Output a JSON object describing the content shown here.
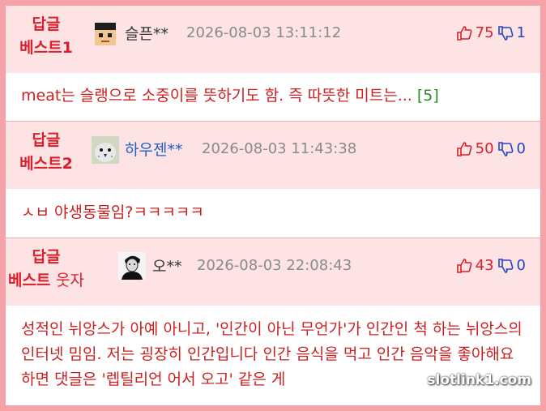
{
  "colors": {
    "border": "#f5a3a8",
    "header_bg": "#fde3e4",
    "badge": "#d81e2b",
    "text": "#cc1f1f",
    "up": "#d81e2b",
    "down": "#1f45c7"
  },
  "comments": [
    {
      "badge_line1": "답글",
      "badge_line2": "베스트1",
      "badge_extra": "",
      "avatar_icon": "pixel-face-avatar",
      "username": "슬픈**",
      "date": "2026-08-03 13:11:12",
      "up": "75",
      "down": "1",
      "body": "meat는 슬랭으로 소중이를 뜻하기도 함. 즉 따뜻한 미트는...",
      "reply_count": "[5]"
    },
    {
      "badge_line1": "답글",
      "badge_line2": "베스트2",
      "badge_extra": "",
      "avatar_icon": "bird-avatar",
      "username": "하우젠**",
      "date": "2026-08-03 11:43:38",
      "up": "50",
      "down": "0",
      "body": "ㅅㅂ 야생동물임?ㅋㅋㅋㅋㅋ",
      "reply_count": ""
    },
    {
      "badge_line1": "답글",
      "badge_line2": "베스트",
      "badge_extra": "웃자",
      "avatar_icon": "man-portrait-avatar",
      "username": "오**",
      "date": "2026-08-03 22:08:43",
      "up": "43",
      "down": "0",
      "body": "성적인 뉘앙스가 아예 아니고, '인간이 아닌 무언가'가 인간인 척 하는 뉘앙스의 인터넷 밈임. 저는 굉장히 인간입니다 인간 음식을 먹고 인간 음악을 좋아해요 하면 댓글은 '렙틸리언 어서 오고' 같은 게",
      "reply_count": ""
    }
  ],
  "watermark": "slotlink1.com"
}
